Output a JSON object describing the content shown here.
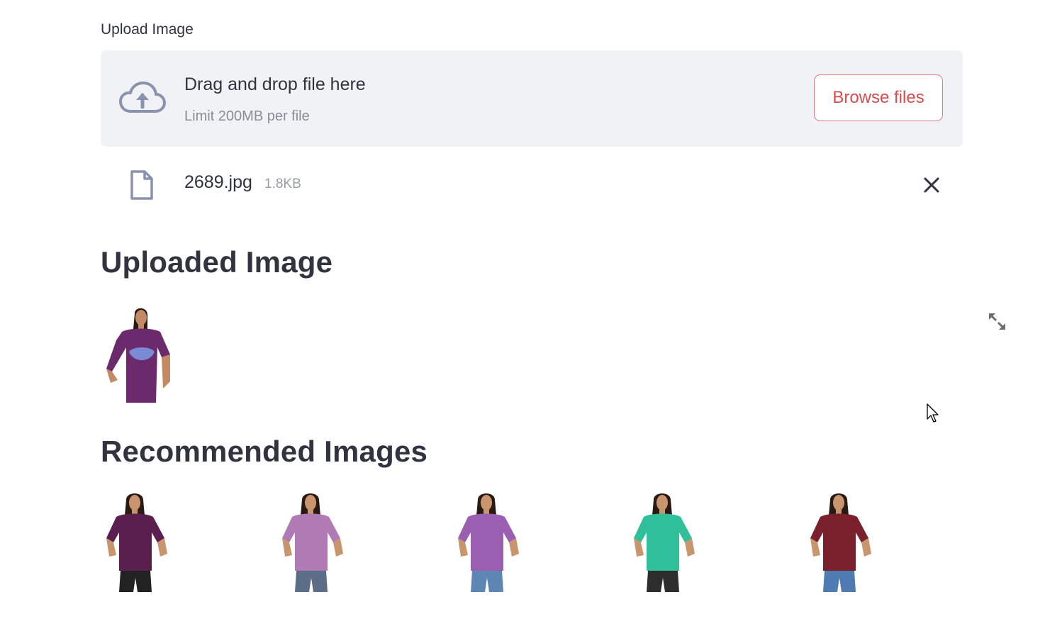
{
  "uploader": {
    "label": "Upload Image",
    "drop_title": "Drag and drop file here",
    "limit_text": "Limit 200MB per file",
    "browse_label": "Browse files",
    "upload_icon": "cloud-upload-icon"
  },
  "file": {
    "name": "2689.jpg",
    "size": "1.8KB",
    "file_icon": "file-icon",
    "remove_icon": "close-icon"
  },
  "uploaded_section": {
    "heading": "Uploaded Image",
    "image": {
      "shirt_color": "#6b2a6b",
      "print_color": "#7a8ad6"
    }
  },
  "recommended_section": {
    "heading": "Recommended Images",
    "images": [
      {
        "shirt_color": "#5a1f4f",
        "pants_color": "#222222"
      },
      {
        "shirt_color": "#b07ab5",
        "pants_color": "#5c6e87"
      },
      {
        "shirt_color": "#9a5fb0",
        "pants_color": "#5e86b5"
      },
      {
        "shirt_color": "#2fbf9a",
        "pants_color": "#2d2d2d"
      },
      {
        "shirt_color": "#7a1f2c",
        "pants_color": "#4f7bb3"
      }
    ]
  },
  "colors": {
    "accent": "#d84b4b",
    "dropzone_bg": "#f0f2f6",
    "icon_gray": "#8a93ad"
  }
}
